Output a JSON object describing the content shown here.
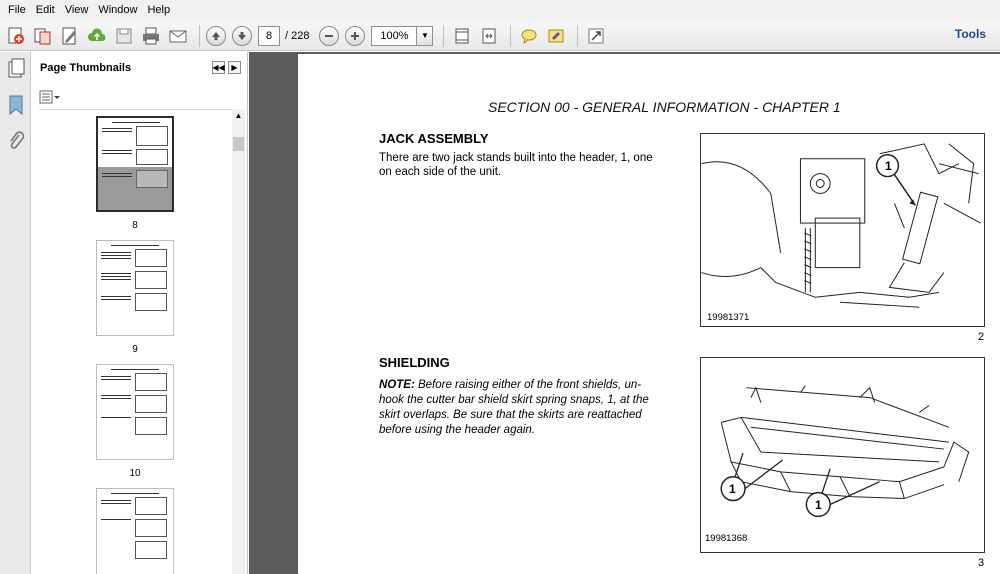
{
  "menu": [
    "File",
    "Edit",
    "View",
    "Window",
    "Help"
  ],
  "toolbar": {
    "page_current": "8",
    "page_total": "/ 228",
    "zoom": "100%",
    "tools_label": "Tools"
  },
  "thumbnails": {
    "title": "Page Thumbnails",
    "pages": [
      "8",
      "9",
      "10"
    ]
  },
  "page": {
    "section_title": "SECTION 00 - GENERAL INFORMATION - CHAPTER 1",
    "jack": {
      "heading": "JACK ASSEMBLY",
      "body_line1": "There are two jack stands built into the header, 1, one",
      "body_line2": "on each side of the unit.",
      "figure_id": "19981371",
      "figure_number": "2",
      "callout": "1"
    },
    "shielding": {
      "heading": "SHIELDING",
      "note_label": "NOTE:",
      "line1": " Before raising either of the front shields, un-",
      "line2": "hook the cutter bar shield skirt spring snaps, 1, at the",
      "line3": "skirt overlaps. Be sure that the skirts are reattached",
      "line4": "before using the header again.",
      "figure_id": "19981368",
      "figure_number": "3",
      "callout_a": "1",
      "callout_b": "1"
    }
  }
}
